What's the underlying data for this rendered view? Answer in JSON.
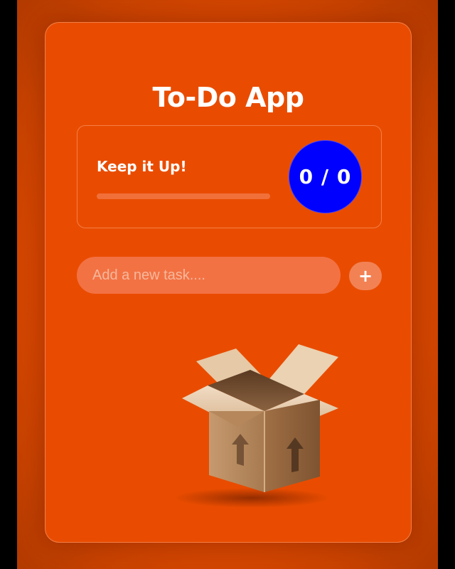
{
  "app": {
    "title": "To-Do App"
  },
  "stats": {
    "heading": "Keep it Up!",
    "counter": "0 / 0",
    "completed": 0,
    "total": 0,
    "progress_fraction": 0
  },
  "new_task": {
    "placeholder": "Add a new task....",
    "value": "",
    "add_label": "+"
  },
  "empty_state": {
    "icon": "open-box-icon"
  },
  "colors": {
    "background": "#e94c00",
    "counter_circle": "#0000ff",
    "text": "#ffffff"
  }
}
